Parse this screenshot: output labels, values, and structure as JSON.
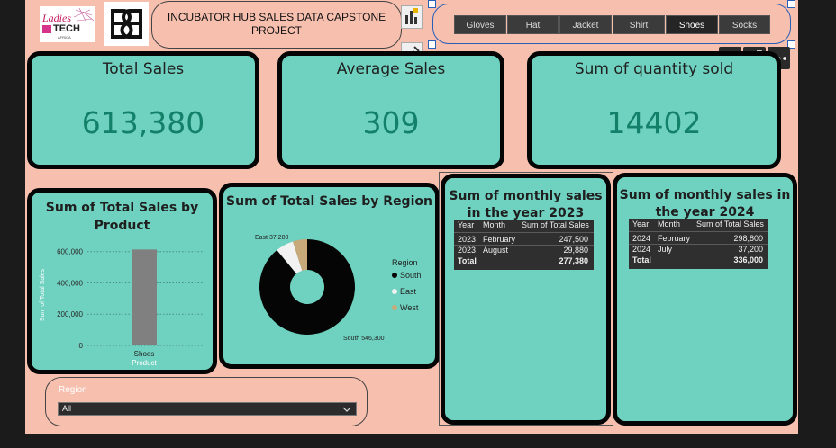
{
  "header": {
    "logo_ladies_line1": "Ladies",
    "logo_ladies_line2": "TECH",
    "logo_ladies_line3": "AFRICA",
    "title_line1": "INCUBATOR HUB SALES DATA CAPSTONE",
    "title_line2": "PROJECT"
  },
  "product_slicer": {
    "items": [
      "Gloves",
      "Hat",
      "Jacket",
      "Shirt",
      "Shoes",
      "Socks"
    ],
    "selected": "Shoes"
  },
  "kpis": [
    {
      "title": "Total Sales",
      "value": "613,380"
    },
    {
      "title": "Average Sales",
      "value": "309"
    },
    {
      "title": "Sum of quantity sold",
      "value": "14402"
    }
  ],
  "bar_card": {
    "title_line1": "Sum of Total Sales by",
    "title_line2": "Product"
  },
  "donut_card": {
    "title": "Sum of Total Sales by Region"
  },
  "table_2023": {
    "title_line1": "Sum of monthly sales",
    "title_line2": "in the year 2023",
    "headers": [
      "Year",
      "Month",
      "Sum of Total Sales"
    ],
    "rows": [
      [
        "2023",
        "February",
        "247,500"
      ],
      [
        "2023",
        "August",
        "29,880"
      ]
    ],
    "total_label": "Total",
    "total_value": "277,380"
  },
  "table_2024": {
    "title_line1": "Sum of monthly sales in",
    "title_line2": "the year 2024",
    "headers": [
      "Year",
      "Month",
      "Sum of Total Sales"
    ],
    "rows": [
      [
        "2024",
        "February",
        "298,800"
      ],
      [
        "2024",
        "July",
        "37,200"
      ]
    ],
    "total_label": "Total",
    "total_value": "336,000"
  },
  "region_slicer": {
    "label": "Region",
    "value": "All"
  },
  "colors": {
    "canvas": "#f6bfae",
    "card": "#6fd1bf",
    "kpi_value": "#138069",
    "south": "#050505",
    "east": "#f2f2f2",
    "west": "#c7a97a",
    "bar": "#808080"
  },
  "chart_data": [
    {
      "type": "bar",
      "categories": [
        "Shoes"
      ],
      "values": [
        613380
      ],
      "xlabel": "Product",
      "ylabel": "Sum of Total Sales",
      "yticks": [
        "600,000",
        "400,000",
        "200,000",
        "0"
      ],
      "ytick_values": [
        600000,
        400000,
        200000,
        0
      ],
      "ylim": [
        0,
        650000
      ],
      "grid": true
    },
    {
      "type": "pie",
      "categories": [
        "South",
        "East",
        "West"
      ],
      "values": [
        546300,
        37200,
        29880
      ],
      "data_labels": [
        "South 546,300",
        "East 37,200"
      ],
      "legend_title": "Region",
      "legend": [
        "South",
        "East",
        "West"
      ],
      "legend_position": "right"
    }
  ]
}
